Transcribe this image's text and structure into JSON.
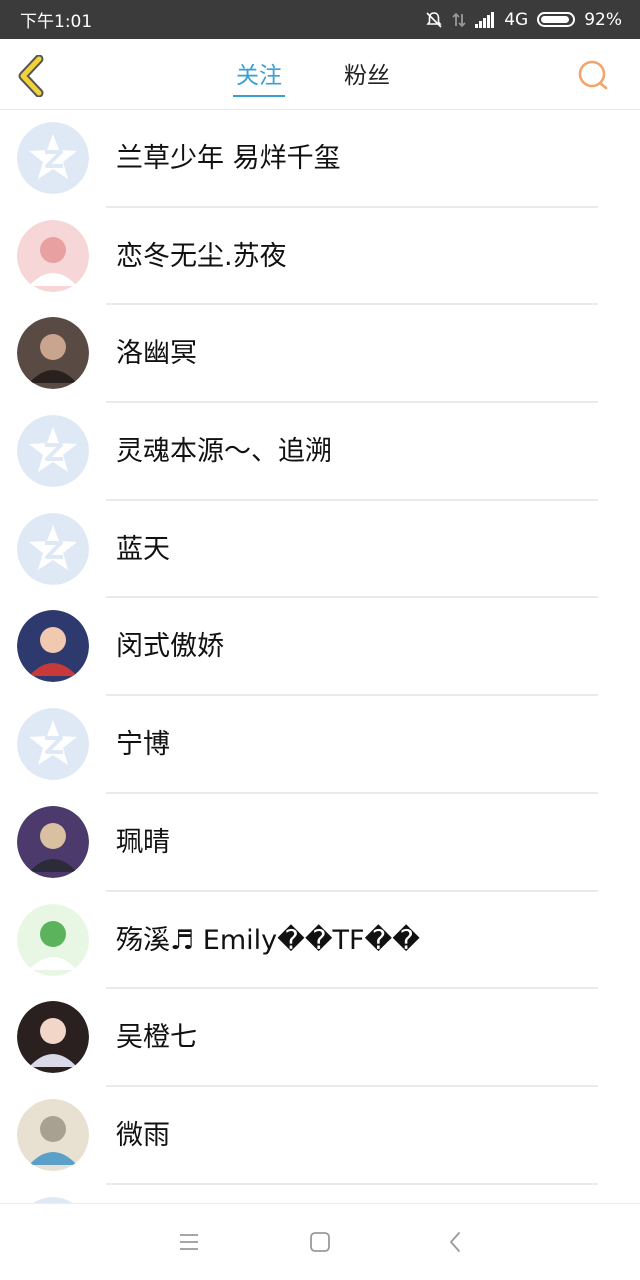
{
  "status_bar": {
    "time": "下午1:01",
    "network": "4G",
    "battery": "92%",
    "battery_level": 0.92
  },
  "header": {
    "back_icon": "chevron-left-icon",
    "tabs": [
      {
        "label": "关注",
        "active": true
      },
      {
        "label": "粉丝",
        "active": false
      }
    ],
    "search_icon": "search-icon",
    "accent_color": "#3aa0d4",
    "back_color": "#f2d23a",
    "search_color": "#f4a36b"
  },
  "users": [
    {
      "name": "兰草少年 易烊千玺",
      "avatar": "default-avatar"
    },
    {
      "name": "恋冬无尘.苏夜",
      "avatar": "photo-avatar"
    },
    {
      "name": "洛幽冥",
      "avatar": "photo-avatar"
    },
    {
      "name": "灵魂本源～、追溯",
      "avatar": "default-avatar"
    },
    {
      "name": "蓝天",
      "avatar": "default-avatar"
    },
    {
      "name": "闵式傲娇",
      "avatar": "photo-avatar"
    },
    {
      "name": "宁博",
      "avatar": "default-avatar"
    },
    {
      "name": "珮晴",
      "avatar": "photo-avatar"
    },
    {
      "name": "殇溪♬ Emily��TF��",
      "avatar": "photo-avatar"
    },
    {
      "name": "吴橙七",
      "avatar": "photo-avatar"
    },
    {
      "name": "微雨",
      "avatar": "photo-avatar"
    },
    {
      "name": "",
      "avatar": "default-avatar"
    }
  ],
  "nav_bar": {
    "menu_icon": "menu-icon",
    "home_icon": "home-square-icon",
    "back_icon": "back-triangle-icon"
  }
}
